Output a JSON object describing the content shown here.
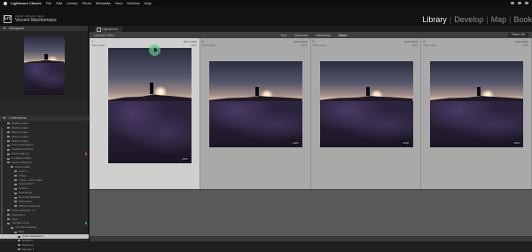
{
  "menubar": {
    "app_name": "Lightroom Classic",
    "items": [
      "File",
      "Edit",
      "Library",
      "Photo",
      "Metadata",
      "View",
      "Window",
      "Help"
    ]
  },
  "identity": {
    "logo": "LrC",
    "subtitle": "Adobe Lightroom Classic",
    "name": "Vincent Machtomans"
  },
  "modules": [
    "Library",
    "Develop",
    "Map",
    "Book"
  ],
  "active_module": "Library",
  "left_panel": {
    "navigator_label": "Navigator",
    "collections_label": "Collections",
    "collections": [
      {
        "label": "2018 by folder",
        "count": ""
      },
      {
        "label": "2019 by folder",
        "count": ""
      },
      {
        "label": "2020 by folder",
        "count": ""
      },
      {
        "label": "2021 by folder",
        "count": ""
      },
      {
        "label": "2022 by folder",
        "count": ""
      },
      {
        "label": "ACC Competitions",
        "count": ""
      },
      {
        "label": "Inspiration Photos",
        "count": ""
      },
      {
        "label": "Prints (gallery)",
        "count": ""
      },
      {
        "label": "Lockdown rallies",
        "count": ""
      },
      {
        "label": "Smart Collections",
        "count": ""
      },
      {
        "label": "Other smalls",
        "count": ""
      },
      {
        "label": "Color A",
        "count": ""
      },
      {
        "label": "4 Star",
        "count": ""
      },
      {
        "label": "4 Star + JAS A Filler",
        "count": ""
      },
      {
        "label": "Colored Red",
        "count": ""
      },
      {
        "label": "Colored",
        "count": ""
      },
      {
        "label": "Past Month",
        "count": ""
      },
      {
        "label": "Recently Modified",
        "count": ""
      },
      {
        "label": "Video Files",
        "count": ""
      },
      {
        "label": "Without Keywords",
        "count": ""
      },
      {
        "label": "Smart Collection +4",
        "count": ""
      },
      {
        "label": "Inspirations",
        "count": ""
      },
      {
        "label": "Moon",
        "count": ""
      },
      {
        "label": "YouTube Vlogs",
        "count": ""
      },
      {
        "label": "YouTube Tutorials",
        "count": ""
      },
      {
        "label": "Misc",
        "count": ""
      },
      {
        "label": "Ursip Heatherless",
        "count": ""
      },
      {
        "label": "Heathers",
        "count": ""
      },
      {
        "label": "Episode 2",
        "count": ""
      },
      {
        "label": "Episode 1",
        "count": ""
      }
    ]
  },
  "tab": {
    "label": "Lightroom"
  },
  "filterbar": {
    "label": "Library Filter :",
    "options": [
      "Text",
      "Attribute",
      "Metadata",
      "None"
    ],
    "active_option": "None",
    "preset": "Filters Off"
  },
  "grid": [
    {
      "num": "1",
      "meta": "Index Label",
      "dims": "6027x4000",
      "ext": "ARW",
      "selected": true
    },
    {
      "num": "2",
      "meta": "Index Label",
      "dims": "6027x4000",
      "ext": "ARW",
      "selected": false
    },
    {
      "num": "3",
      "meta": "Index Label",
      "dims": "6027x4000",
      "ext": "ARW",
      "selected": false
    },
    {
      "num": "4",
      "meta": "Index Label",
      "dims": "6027x4000",
      "ext": "ARW",
      "selected": false
    }
  ],
  "badge": "ARW"
}
